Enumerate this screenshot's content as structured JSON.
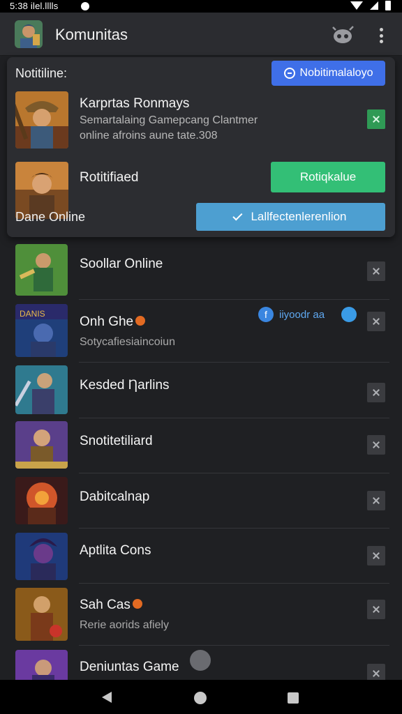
{
  "status_bar": {
    "time": "5:38 ilel.lllls"
  },
  "app_bar": {
    "title": "Komunitas"
  },
  "notification": {
    "label": "Notitiline:",
    "button_label": "Nobitimalaloyo",
    "featured": {
      "title": "Karprtas Ronmays",
      "description": "Semartalaing Gamepcang Clantmer online afroins aune tate.308"
    },
    "second": {
      "title": "Rotitifiaed",
      "subtitle": "Dane Online",
      "green_button": "Rotiqkalue",
      "blue_button": "Lallfectenlerenlion"
    }
  },
  "items": [
    {
      "title": "Soollar Online",
      "subtitle": ""
    },
    {
      "title": "Onh Ghe",
      "subtitle": "Sotycafiesiaincoiun",
      "tag": "iiyoodr aa",
      "tag_badge": "f"
    },
    {
      "title": "Kesded Ƞarlins",
      "subtitle": ""
    },
    {
      "title": "Snotitetiliard",
      "subtitle": ""
    },
    {
      "title": "Dabitcalnap",
      "subtitle": ""
    },
    {
      "title": "Aptlita Cons",
      "subtitle": ""
    },
    {
      "title": "Sah Cas",
      "subtitle": "Rerie aorids afiely"
    },
    {
      "title": "Deniuntas Game",
      "subtitle": ""
    }
  ],
  "colors": {
    "background": "#1f2023",
    "app_bar": "#2b2c30",
    "primary_blue": "#3f6fe8",
    "green": "#33bf76",
    "light_blue": "#4d9fd1"
  },
  "icons": {
    "app_bar_right": [
      "bot-icon",
      "more-vert-icon"
    ],
    "row_action": "close-icon",
    "nav": [
      "back-icon",
      "home-icon",
      "recent-apps-icon"
    ]
  }
}
